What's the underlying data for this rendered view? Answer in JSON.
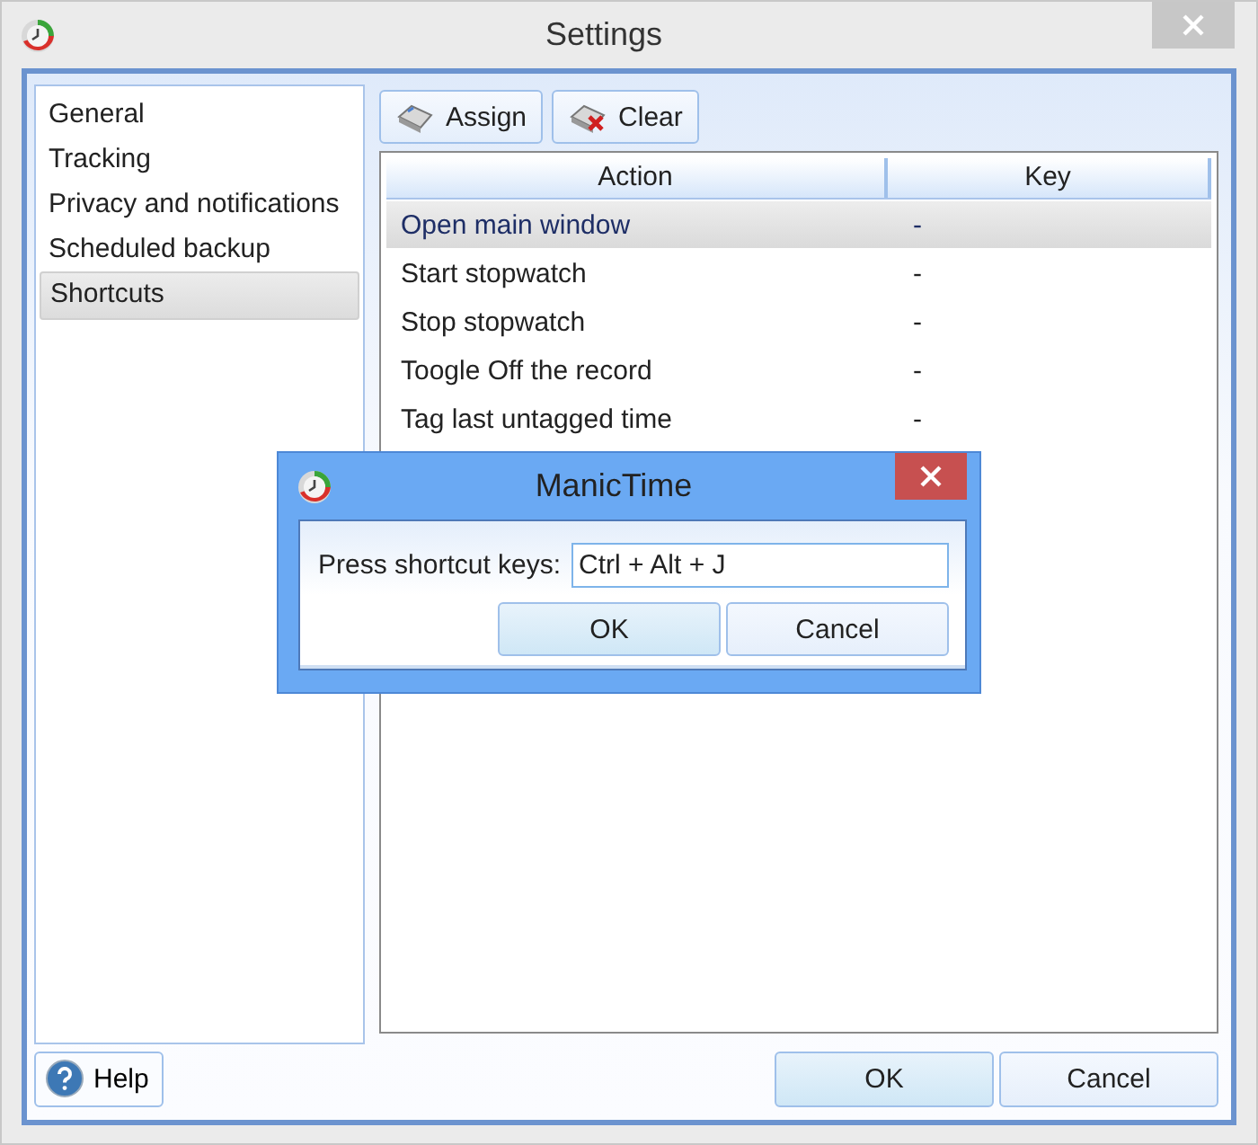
{
  "window": {
    "title": "Settings"
  },
  "sidebar": {
    "items": [
      {
        "label": "General",
        "selected": false
      },
      {
        "label": "Tracking",
        "selected": false
      },
      {
        "label": "Privacy and notifications",
        "selected": false
      },
      {
        "label": "Scheduled backup",
        "selected": false
      },
      {
        "label": "Shortcuts",
        "selected": true
      }
    ]
  },
  "toolbar": {
    "buttons": [
      {
        "label": "Assign",
        "kind": "assign"
      },
      {
        "label": "Clear",
        "kind": "clear"
      }
    ]
  },
  "table": {
    "columns": [
      "Action",
      "Key"
    ],
    "rows": [
      {
        "cells": [
          "Open main window",
          "-"
        ],
        "selected": true
      },
      {
        "cells": [
          "Start stopwatch",
          "-"
        ],
        "selected": false
      },
      {
        "cells": [
          "Stop stopwatch",
          "-"
        ],
        "selected": false
      },
      {
        "cells": [
          "Toogle Off the record",
          "-"
        ],
        "selected": false
      },
      {
        "cells": [
          "Tag last untagged time",
          "-"
        ],
        "selected": false
      }
    ]
  },
  "footer": {
    "help": "Help",
    "ok": "OK",
    "cancel": "Cancel"
  },
  "dialog": {
    "title": "ManicTime",
    "label": "Press shortcut keys:",
    "value": "Ctrl + Alt + J",
    "ok": "OK",
    "cancel": "Cancel"
  }
}
